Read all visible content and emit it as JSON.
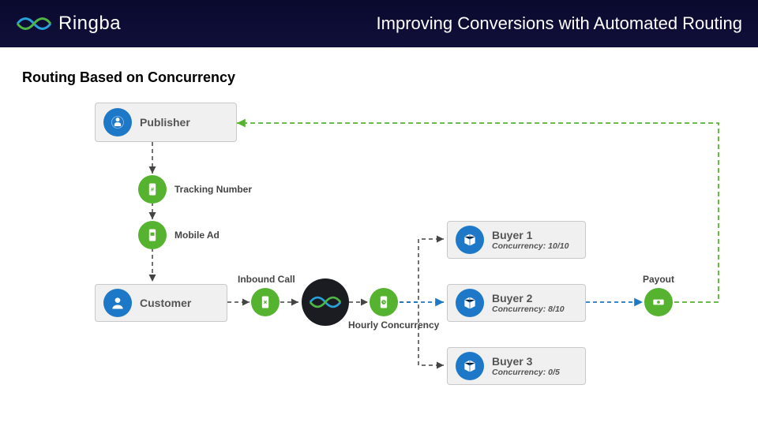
{
  "header": {
    "brand": "Ringba",
    "title": "Improving Conversions with Automated Routing"
  },
  "subtitle": "Routing Based on Concurrency",
  "nodes": {
    "publisher": {
      "label": "Publisher"
    },
    "trackingNumber": {
      "label": "Tracking Number"
    },
    "mobileAd": {
      "label": "Mobile Ad"
    },
    "customer": {
      "label": "Customer"
    },
    "inboundCall": {
      "label": "Inbound Call"
    },
    "hourlyConcurrency": {
      "label": "Hourly Concurrency"
    },
    "buyer1": {
      "label": "Buyer 1",
      "sub": "Concurrency: 10/10"
    },
    "buyer2": {
      "label": "Buyer 2",
      "sub": "Concurrency: 8/10"
    },
    "buyer3": {
      "label": "Buyer 3",
      "sub": "Concurrency: 0/5"
    },
    "payout": {
      "label": "Payout"
    }
  },
  "colors": {
    "blue": "#1e78c8",
    "green": "#55b330",
    "headerBg": "#0a0a2e",
    "cardBg": "#f0f0f0",
    "arrowDark": "#444444",
    "arrowBlue": "#1e78c8",
    "arrowGreen": "#55b330"
  },
  "icons": {
    "publisher": "person-pin-icon",
    "trackingNumber": "phone-hash-icon",
    "mobileAd": "phone-ad-icon",
    "customer": "user-icon",
    "inboundCall": "phone-call-icon",
    "hourlyConcurrency": "phone-clock-icon",
    "buyer": "box-icon",
    "payout": "money-icon",
    "platform": "ringba-wave-icon"
  }
}
